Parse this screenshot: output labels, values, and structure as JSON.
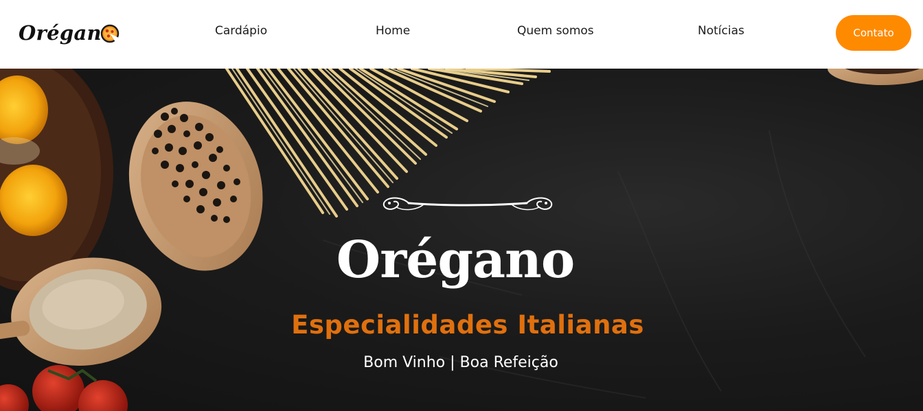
{
  "brand": {
    "logo_text": "Orégan",
    "accent_color": "#fe8a00"
  },
  "nav": {
    "items": [
      {
        "label": "Cardápio"
      },
      {
        "label": "Home"
      },
      {
        "label": "Quem somos"
      },
      {
        "label": "Notícias"
      }
    ],
    "contact_label": "Contato"
  },
  "hero": {
    "title": "Orégano",
    "subtitle": "Especialidades Italianas",
    "tagline": "Bom Vinho | Boa Refeição",
    "subtitle_color": "#e0700e"
  }
}
